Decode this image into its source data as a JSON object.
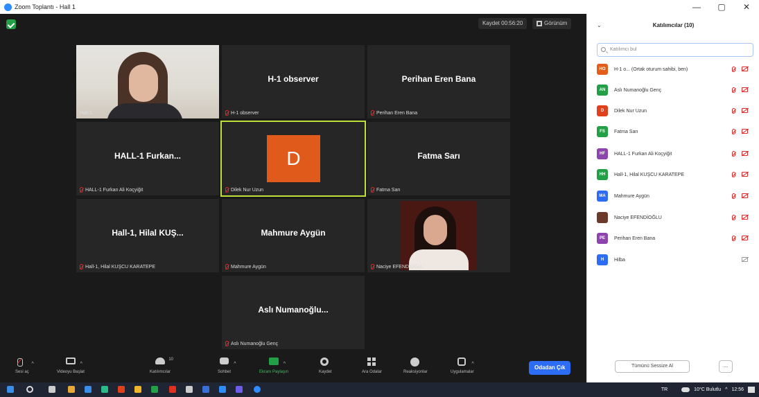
{
  "window": {
    "title": "Zoom Toplantı - Hall 1",
    "controls": [
      "—",
      "▢",
      "✕"
    ]
  },
  "topbar": {
    "recording": "Kaydet 00:56:20",
    "view": "Görünüm"
  },
  "tiles": [
    {
      "id": "hall1",
      "big": "",
      "label": "Hall 1",
      "video": true
    },
    {
      "id": "h1obs",
      "big": "H-1 observer",
      "label": "H-1 observer"
    },
    {
      "id": "perihan",
      "big": "Perihan Eren Bana",
      "label": "Perihan Eren Bana"
    },
    {
      "id": "furkan",
      "big": "HALL-1 Furkan...",
      "label": "HALL-1 Furkan Ali Koçyiğit"
    },
    {
      "id": "dilek",
      "big": "",
      "label": "Dilek Nur Uzun",
      "avatar": "D"
    },
    {
      "id": "fatma",
      "big": "Fatma Sarı",
      "label": "Fatma Sarı"
    },
    {
      "id": "hilal",
      "big": "Hall-1, Hilal KUŞ...",
      "label": "Hall-1, Hilal KUŞCU KARATEPE"
    },
    {
      "id": "mahmure",
      "big": "Mahmure Aygün",
      "label": "Mahmure Aygün"
    },
    {
      "id": "naciye",
      "big": "",
      "label": "Naciye EFENDİOĞLU",
      "video": true
    },
    {
      "id": "asli",
      "big": "Aslı Numanoğlu...",
      "label": "Aslı Numanoğlu Genç"
    }
  ],
  "toolbar": {
    "mute": "Sesi aç",
    "video": "Videoyu Başlat",
    "participants": "Katılımcılar",
    "participants_count": "10",
    "chat": "Sohbet",
    "share": "Ekranı Paylaşın",
    "record": "Kaydet",
    "breakout": "Ara Odalar",
    "reactions": "Reaksiyonlar",
    "apps": "Uygulamalar",
    "leave": "Odadan Çık"
  },
  "panel": {
    "title": "Katılımcılar (10)",
    "search_placeholder": "Katılımcı bul",
    "participants": [
      {
        "initials": "HO",
        "color": "#e35d1b",
        "name": "H-1 o... (Ortak oturum sahibi, ben)",
        "cam": "red"
      },
      {
        "initials": "AN",
        "color": "#23a047",
        "name": "Aslı Numanoğlu Genç",
        "cam": "red"
      },
      {
        "initials": "D",
        "color": "#e0401c",
        "name": "Dilek Nur Uzun",
        "cam": "red"
      },
      {
        "initials": "FS",
        "color": "#23a047",
        "name": "Fatma Sarı",
        "cam": "red"
      },
      {
        "initials": "HF",
        "color": "#8e44ad",
        "name": "HALL-1 Furkan Ali Koçyiğit",
        "cam": "red"
      },
      {
        "initials": "HH",
        "color": "#23a047",
        "name": "Hall-1, Hilal KUŞCU KARATEPE",
        "cam": "red"
      },
      {
        "initials": "MA",
        "color": "#2d6df6",
        "name": "Mahmure Aygün",
        "cam": "red"
      },
      {
        "initials": "",
        "color": "#6b3a2a",
        "name": "Naciye EFENDİOĞLU",
        "cam": "red"
      },
      {
        "initials": "PE",
        "color": "#8e44ad",
        "name": "Perihan Eren Bana",
        "cam": "red"
      },
      {
        "initials": "H",
        "color": "#2d6df6",
        "name": "Hilba",
        "cam": "grey"
      }
    ],
    "invite": "Tümünü Sessize Al",
    "more": "..."
  },
  "taskbar": {
    "lang": "TR",
    "weather": "10°C Bulutlu",
    "time": "12:56"
  }
}
